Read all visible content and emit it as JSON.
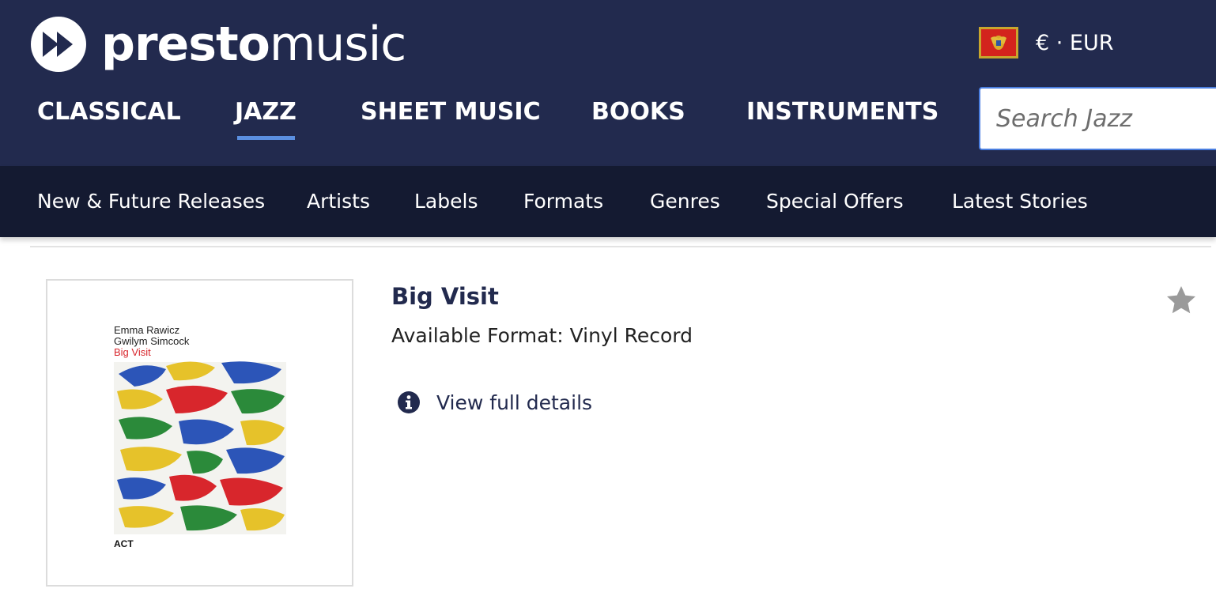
{
  "logo": {
    "word_bold": "presto",
    "word_light": "music"
  },
  "locale": {
    "flag_icon": "montenegro-flag-icon",
    "currency": "€ · EUR"
  },
  "main_nav": {
    "items": [
      {
        "label": "CLASSICAL",
        "active": false
      },
      {
        "label": "JAZZ",
        "active": true
      },
      {
        "label": "SHEET MUSIC",
        "active": false
      },
      {
        "label": "BOOKS",
        "active": false
      },
      {
        "label": "INSTRUMENTS",
        "active": false
      }
    ]
  },
  "search": {
    "placeholder": "Search Jazz",
    "value": ""
  },
  "sub_nav": {
    "items": [
      {
        "label": "New & Future Releases"
      },
      {
        "label": "Artists"
      },
      {
        "label": "Labels"
      },
      {
        "label": "Formats"
      },
      {
        "label": "Genres"
      },
      {
        "label": "Special Offers"
      },
      {
        "label": "Latest Stories"
      }
    ]
  },
  "product": {
    "title": "Big Visit",
    "format": "Available Format: Vinyl Record",
    "details_link": "View full details",
    "cover": {
      "artist_1": "Emma Rawicz",
      "artist_2": "Gwilym Simcock",
      "title": "Big Visit",
      "label": "ACT"
    }
  },
  "colors": {
    "header_bg": "#222a4e",
    "subnav_bg": "#141a31",
    "accent": "#5b8fe0",
    "star": "#9a9a9a",
    "cover_title": "#d8262c"
  },
  "icons": {
    "logo": "play-forward-logo-icon",
    "info": "info-icon",
    "favourite": "star-icon"
  }
}
